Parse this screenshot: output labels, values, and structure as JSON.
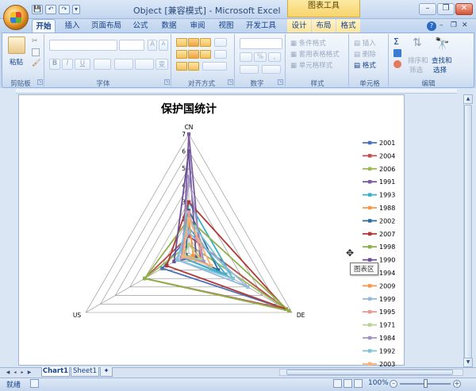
{
  "window": {
    "title": "Object  [兼容模式] - Microsoft Excel",
    "context_tab_group": "图表工具",
    "minimize": "–",
    "restore": "❐",
    "close": "✕",
    "ribbon_min": "–",
    "ribbon_restore": "❐",
    "ribbon_close": "✕",
    "help": "?"
  },
  "qat": {
    "save": "💾",
    "undo": "↶",
    "redo": "↷",
    "customize": "▾"
  },
  "tabs": [
    {
      "label": "开始",
      "active": true
    },
    {
      "label": "插入"
    },
    {
      "label": "页面布局"
    },
    {
      "label": "公式"
    },
    {
      "label": "数据"
    },
    {
      "label": "审阅"
    },
    {
      "label": "视图"
    },
    {
      "label": "开发工具"
    },
    {
      "label": "设计",
      "contextual": true
    },
    {
      "label": "布局",
      "contextual": true
    },
    {
      "label": "格式",
      "contextual": true
    }
  ],
  "ribbon": {
    "clipboard": {
      "label": "剪贴板",
      "paste": "粘贴"
    },
    "font": {
      "label": "字体",
      "bold": "B",
      "italic": "I",
      "underline": "U",
      "grow": "A",
      "shrink": "A",
      "phonetic": "变"
    },
    "alignment": {
      "label": "对齐方式"
    },
    "number": {
      "label": "数字",
      "percent": "%",
      "comma": ","
    },
    "styles": {
      "label": "样式",
      "conditional": "条件格式",
      "table": "套用表格格式",
      "cell": "单元格样式"
    },
    "cells": {
      "label": "单元格",
      "insert": "插入",
      "delete": "删除",
      "format": "格式"
    },
    "editing": {
      "label": "编辑",
      "sum": "Σ",
      "sort": "排序和",
      "sort2": "筛选",
      "find": "查找和",
      "find2": "选择"
    }
  },
  "chart_data": {
    "type": "radar",
    "title": "保护国统计",
    "categories": [
      "CN",
      "DE",
      "US"
    ],
    "rlim": [
      0,
      7
    ],
    "ticks": [
      "0",
      "1",
      "2",
      "3",
      "4",
      "5",
      "6",
      "7"
    ],
    "grid": true,
    "legend": "right",
    "series": [
      {
        "name": "2001",
        "color": "#4a72b7",
        "values": [
          1,
          6.6,
          1.8
        ]
      },
      {
        "name": "2004",
        "color": "#c0504d",
        "values": [
          1,
          6.6,
          3
        ]
      },
      {
        "name": "2006",
        "color": "#9bbb59",
        "values": [
          0.5,
          6.8,
          3
        ]
      },
      {
        "name": "1991",
        "color": "#7a5da0",
        "values": [
          7,
          0.8,
          0.4
        ]
      },
      {
        "name": "1993",
        "color": "#3caec8",
        "values": [
          3,
          3,
          0.5
        ]
      },
      {
        "name": "1988",
        "color": "#f59a4a",
        "values": [
          0.5,
          1,
          0.5
        ]
      },
      {
        "name": "2002",
        "color": "#2c6c9a",
        "values": [
          2.5,
          2,
          0.2
        ]
      },
      {
        "name": "2007",
        "color": "#b23a36",
        "values": [
          3,
          6.6,
          1.5
        ]
      },
      {
        "name": "1998",
        "color": "#8eb04c",
        "values": [
          2,
          6.8,
          3
        ]
      },
      {
        "name": "1990",
        "color": "#6c4e96",
        "values": [
          6,
          0.5,
          1
        ]
      },
      {
        "name": "1994",
        "color": "#4bacc6",
        "values": [
          1.5,
          2.5,
          0.5
        ]
      },
      {
        "name": "2009",
        "color": "#f79646",
        "values": [
          2,
          0.3,
          0.5
        ]
      },
      {
        "name": "1999",
        "color": "#97b9e0",
        "values": [
          1.2,
          4,
          0.8
        ]
      },
      {
        "name": "1995",
        "color": "#e59a98",
        "values": [
          2.4,
          1,
          0.5
        ]
      },
      {
        "name": "1971",
        "color": "#b6d294",
        "values": [
          0.5,
          0.8,
          0.3
        ]
      },
      {
        "name": "1984",
        "color": "#a593c4",
        "values": [
          4.5,
          1,
          0.5
        ]
      },
      {
        "name": "1992",
        "color": "#7fc3d6",
        "values": [
          2,
          3,
          0.8
        ]
      },
      {
        "name": "2003",
        "color": "#f9b277",
        "values": [
          2,
          1.5,
          0.4
        ]
      }
    ]
  },
  "tooltip": "图表区",
  "sheets": [
    {
      "label": "Chart1",
      "active": true
    },
    {
      "label": "Sheet1"
    }
  ],
  "status": {
    "ready": "就绪",
    "zoom": "100%",
    "zoom_out": "–",
    "zoom_in": "+"
  }
}
